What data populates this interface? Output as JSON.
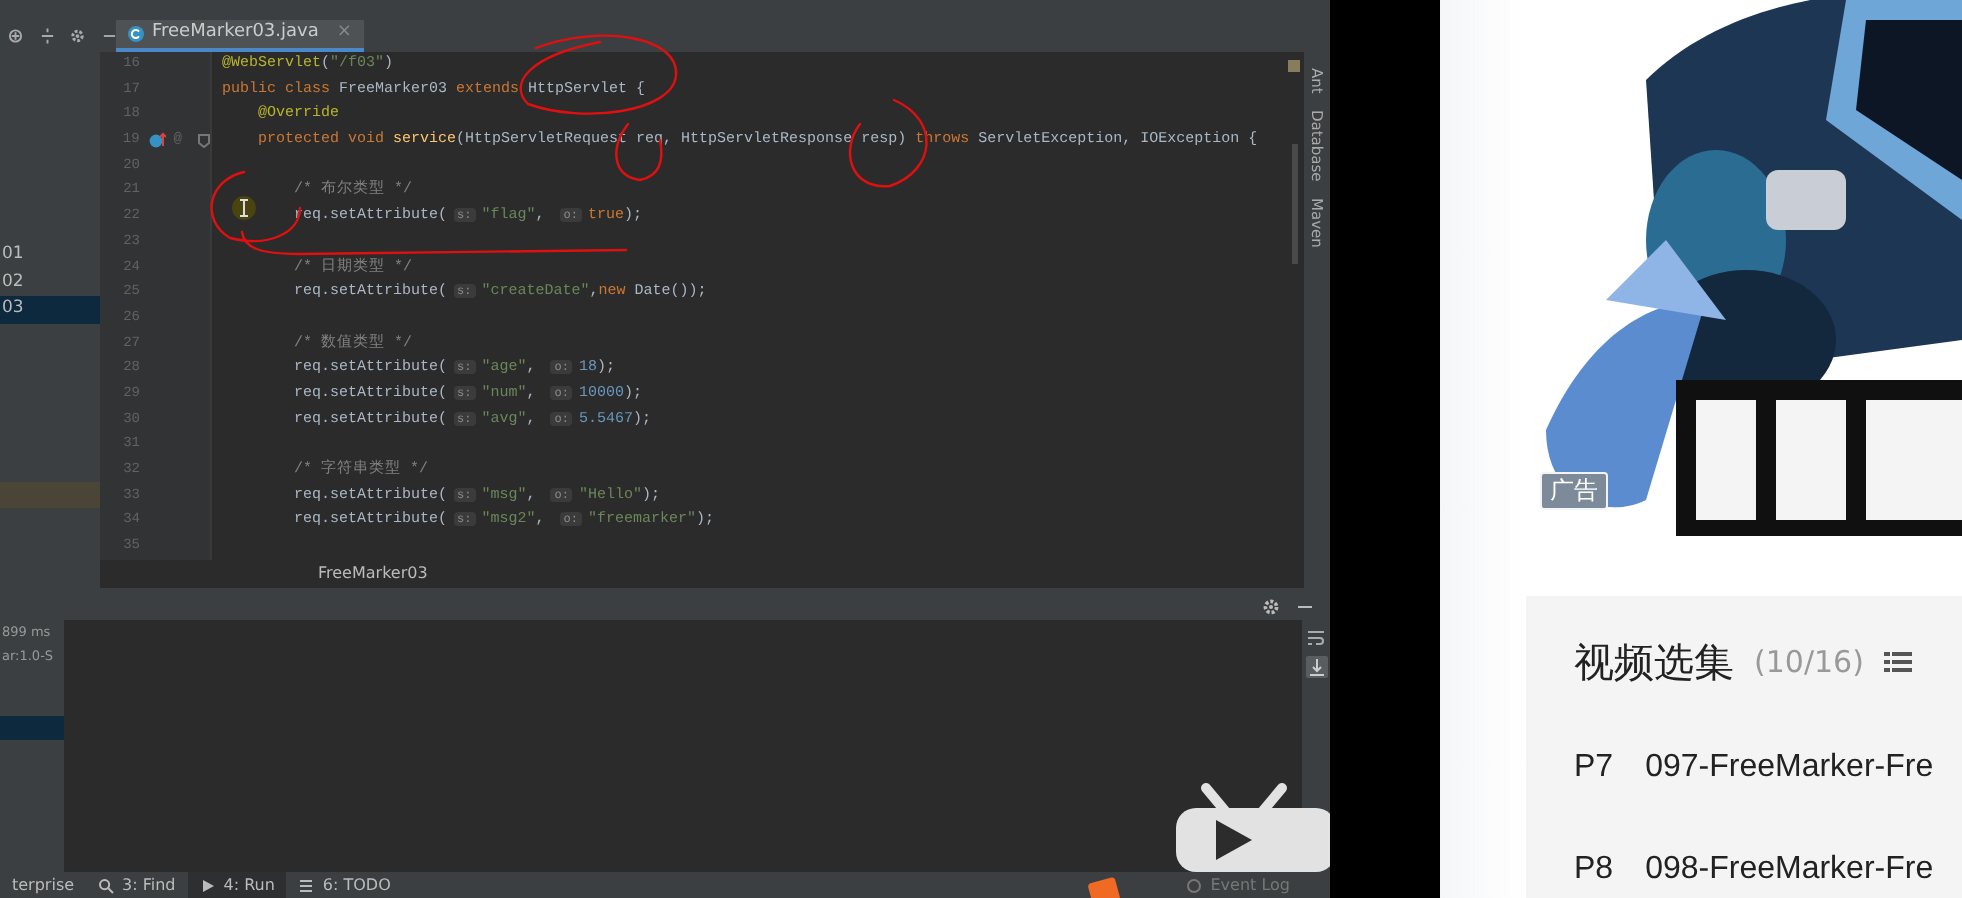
{
  "ide": {
    "editor_tab": {
      "label": "FreeMarker03.java",
      "close": "×",
      "selected": true
    },
    "project_items": [
      {
        "label": "01",
        "selected": false,
        "highlighted": false
      },
      {
        "label": "02",
        "selected": false,
        "highlighted": false
      },
      {
        "label": "03",
        "selected": true,
        "highlighted": false
      },
      {
        "selected": false,
        "highlighted": true
      }
    ],
    "code_lines": [
      {
        "number": "16",
        "tokens": [
          {
            "text": "@WebServlet",
            "kind": "annotation"
          },
          {
            "text": "(",
            "kind": "plain"
          },
          {
            "text": "\"/f03\"",
            "kind": "string"
          },
          {
            "text": ")",
            "kind": "plain"
          }
        ]
      },
      {
        "number": "17",
        "tokens": [
          {
            "text": "public class ",
            "kind": "keyword"
          },
          {
            "text": "FreeMarker03 ",
            "kind": "plain"
          },
          {
            "text": "extends ",
            "kind": "keyword"
          },
          {
            "text": "HttpServlet {",
            "kind": "plain"
          }
        ]
      },
      {
        "number": "18",
        "tokens": [
          {
            "text": "    @Override",
            "kind": "annotation"
          }
        ]
      },
      {
        "number": "19",
        "override": true,
        "gutter_text": "@",
        "fold": true,
        "tokens": [
          {
            "text": "    protected void ",
            "kind": "keyword"
          },
          {
            "text": "service",
            "kind": "method"
          },
          {
            "text": "(HttpServletRequest req, HttpServletResponse resp) ",
            "kind": "plain"
          },
          {
            "text": "throws ",
            "kind": "keyword"
          },
          {
            "text": "ServletException, IOException {",
            "kind": "plain"
          }
        ]
      },
      {
        "number": "20"
      },
      {
        "number": "21",
        "tokens": [
          {
            "text": "        /* 布尔类型 */",
            "kind": "comment"
          }
        ]
      },
      {
        "number": "22",
        "tokens": [
          {
            "text": "        req.setAttribute(",
            "kind": "plain"
          },
          {
            "text": "s:",
            "kind": "hint"
          },
          {
            "text": "\"flag\"",
            "kind": "string"
          },
          {
            "text": ", ",
            "kind": "punct"
          },
          {
            "text": "o:",
            "kind": "hint"
          },
          {
            "text": "true",
            "kind": "keyword"
          },
          {
            "text": ");",
            "kind": "punct"
          }
        ]
      },
      {
        "number": "23"
      },
      {
        "number": "24",
        "tokens": [
          {
            "text": "        /* 日期类型 */",
            "kind": "comment"
          }
        ]
      },
      {
        "number": "25",
        "tokens": [
          {
            "text": "        req.setAttribute(",
            "kind": "plain"
          },
          {
            "text": "s:",
            "kind": "hint"
          },
          {
            "text": "\"createDate\"",
            "kind": "string"
          },
          {
            "text": ",",
            "kind": "punct"
          },
          {
            "text": "new ",
            "kind": "keyword"
          },
          {
            "text": "Date());",
            "kind": "plain"
          }
        ]
      },
      {
        "number": "26"
      },
      {
        "number": "27",
        "tokens": [
          {
            "text": "        /* 数值类型 */",
            "kind": "comment"
          }
        ]
      },
      {
        "number": "28",
        "tokens": [
          {
            "text": "        req.setAttribute(",
            "kind": "plain"
          },
          {
            "text": "s:",
            "kind": "hint"
          },
          {
            "text": "\"age\"",
            "kind": "string"
          },
          {
            "text": ", ",
            "kind": "punct"
          },
          {
            "text": "o:",
            "kind": "hint"
          },
          {
            "text": "18",
            "kind": "number"
          },
          {
            "text": ");",
            "kind": "punct"
          }
        ]
      },
      {
        "number": "29",
        "tokens": [
          {
            "text": "        req.setAttribute(",
            "kind": "plain"
          },
          {
            "text": "s:",
            "kind": "hint"
          },
          {
            "text": "\"num\"",
            "kind": "string"
          },
          {
            "text": ", ",
            "kind": "punct"
          },
          {
            "text": "o:",
            "kind": "hint"
          },
          {
            "text": "10000",
            "kind": "number"
          },
          {
            "text": ");",
            "kind": "punct"
          }
        ]
      },
      {
        "number": "30",
        "tokens": [
          {
            "text": "        req.setAttribute(",
            "kind": "plain"
          },
          {
            "text": "s:",
            "kind": "hint"
          },
          {
            "text": "\"avg\"",
            "kind": "string"
          },
          {
            "text": ", ",
            "kind": "punct"
          },
          {
            "text": "o:",
            "kind": "hint"
          },
          {
            "text": "5.5467",
            "kind": "number"
          },
          {
            "text": ");",
            "kind": "punct"
          }
        ]
      },
      {
        "number": "31"
      },
      {
        "number": "32",
        "tokens": [
          {
            "text": "        /* 字符串类型 */",
            "kind": "comment"
          }
        ]
      },
      {
        "number": "33",
        "tokens": [
          {
            "text": "        req.setAttribute(",
            "kind": "plain"
          },
          {
            "text": "s:",
            "kind": "hint"
          },
          {
            "text": "\"msg\"",
            "kind": "string"
          },
          {
            "text": ", ",
            "kind": "punct"
          },
          {
            "text": "o:",
            "kind": "hint"
          },
          {
            "text": "\"Hello\"",
            "kind": "string"
          },
          {
            "text": ");",
            "kind": "punct"
          }
        ]
      },
      {
        "number": "34",
        "tokens": [
          {
            "text": "        req.setAttribute(",
            "kind": "plain"
          },
          {
            "text": "s:",
            "kind": "hint"
          },
          {
            "text": "\"msg2\"",
            "kind": "string"
          },
          {
            "text": ", ",
            "kind": "punct"
          },
          {
            "text": "o:",
            "kind": "hint"
          },
          {
            "text": "\"freemarker\"",
            "kind": "string"
          },
          {
            "text": ");",
            "kind": "punct"
          }
        ]
      },
      {
        "number": "35"
      }
    ],
    "editor_breadcrumb": "FreeMarker03",
    "tool_stripes": [
      "Ant",
      "Database",
      "Maven"
    ],
    "run_rows": [
      {
        "label": "899 ms",
        "selected": false
      },
      {
        "label": "ar:1.0-S",
        "selected": false
      },
      {
        "selected": true
      }
    ],
    "bottom_tabs": [
      {
        "label": "terprise",
        "kind": "plain",
        "selected": false
      },
      {
        "label": "3: Find",
        "kind": "search",
        "selected": false
      },
      {
        "label": "4: Run",
        "kind": "run",
        "selected": true
      },
      {
        "label": "6: TODO",
        "kind": "todo",
        "selected": false
      }
    ],
    "event_log": "Event Log"
  },
  "page": {
    "ad_badge": "广告",
    "playlist": {
      "title": "视频选集",
      "count": "(10/16)",
      "items": [
        {
          "number": "P7",
          "title": "097-FreeMarker-Fre"
        },
        {
          "number": "P8",
          "title": "098-FreeMarker-Fre"
        }
      ]
    }
  }
}
